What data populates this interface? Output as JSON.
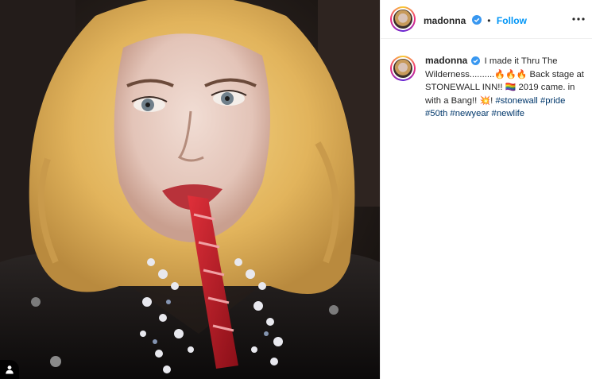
{
  "photo": {
    "alt_icon": "user-tag-icon"
  },
  "header": {
    "username": "madonna",
    "separator": "•",
    "follow_label": "Follow",
    "more_icon": "more-options-icon"
  },
  "caption": {
    "username": "madonna",
    "text_1": "I made it Thru The Wilderness..........",
    "emoji_fire": "🔥🔥🔥",
    "text_2": " Back stage at STONEWALL INN!! ",
    "emoji_flag": "🏳️‍🌈",
    "text_3": " 2019 came. in with a Bang!! ",
    "emoji_boom": "💥",
    "text_4": "! ",
    "tags": [
      "#stonewall",
      "#pride",
      "#50th",
      "#newyear",
      "#newlife"
    ]
  },
  "colors": {
    "link_blue": "#0095f6",
    "hashtag": "#00376b",
    "verified": "#3897f0"
  }
}
